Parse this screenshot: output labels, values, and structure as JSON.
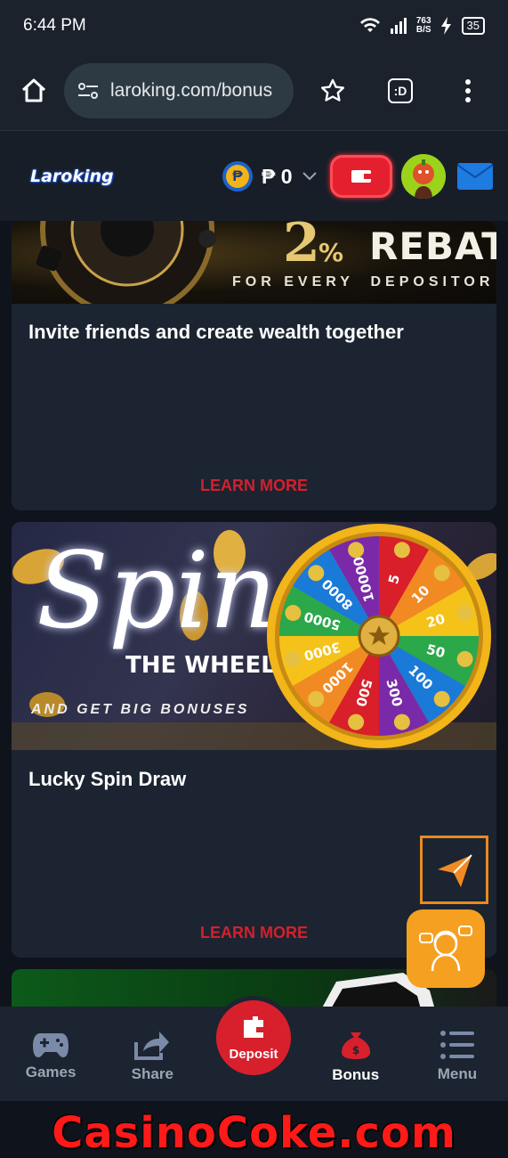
{
  "status_bar": {
    "time": "6:44 PM",
    "network_speed_top": "763",
    "network_speed_bottom": "B/S",
    "battery": "35"
  },
  "browser": {
    "url": "laroking.com/bonus",
    "tab_label": ":D"
  },
  "header": {
    "logo": "Laroking",
    "currency_symbol": "₱",
    "balance": "₱ 0"
  },
  "banner1": {
    "rebate_text": "REBATE",
    "rebate_sub": "FOR EVERY  DEPOSITOR"
  },
  "cards": [
    {
      "title": "Invite friends and create wealth together",
      "learn_more": "LEARN MORE"
    },
    {
      "title": "Lucky Spin Draw",
      "learn_more": "LEARN MORE"
    }
  ],
  "banner2": {
    "spin_text": "Spin",
    "wheel_text": "THE WHEEL",
    "tagline": "AND GET BIG BONUSES",
    "wheel_values": [
      "5",
      "10",
      "20",
      "50",
      "100",
      "300",
      "500",
      "1000",
      "3000",
      "5000",
      "8000",
      "10000"
    ]
  },
  "bottom_nav": {
    "games": "Games",
    "share": "Share",
    "deposit": "Deposit",
    "bonus": "Bonus",
    "menu": "Menu"
  },
  "watermark": "CasinoCoke.com",
  "colors": {
    "accent_red": "#d8202d",
    "nav_bg": "#1b2430",
    "card_bg": "#1b2430",
    "orange": "#f5a021"
  }
}
